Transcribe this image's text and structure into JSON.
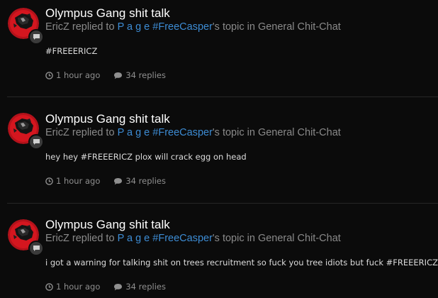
{
  "entries": [
    {
      "title": "Olympus Gang shit talk",
      "author": "EricZ",
      "replied_to": " replied to ",
      "topic_owner": "P a g e #FreeCasper",
      "topic_suffix": "'s topic in ",
      "forum": "General Chit-Chat",
      "body": "#FREEERICZ",
      "time": "1 hour ago",
      "replies": "34 replies"
    },
    {
      "title": "Olympus Gang shit talk",
      "author": "EricZ",
      "replied_to": " replied to ",
      "topic_owner": "P a g e #FreeCasper",
      "topic_suffix": "'s topic in ",
      "forum": "General Chit-Chat",
      "body": "hey hey #FREEERICZ plox will crack egg on head",
      "time": "1 hour ago",
      "replies": "34 replies"
    },
    {
      "title": "Olympus Gang shit talk",
      "author": "EricZ",
      "replied_to": " replied to ",
      "topic_owner": "P a g e #FreeCasper",
      "topic_suffix": "'s topic in ",
      "forum": "General Chit-Chat",
      "body": "i got a warning for talking shit on trees recruitment so fuck you tree idiots but fuck #FREEERICZ",
      "time": "1 hour ago",
      "replies": "34 replies"
    }
  ],
  "icons": {
    "badge": "comment-icon",
    "time": "clock-icon",
    "replies": "speech-bubble-icon"
  },
  "colors": {
    "background": "#0b0b0b",
    "title": "#ffffff",
    "link": "#3d8cd4",
    "muted": "#8a8a8a"
  }
}
